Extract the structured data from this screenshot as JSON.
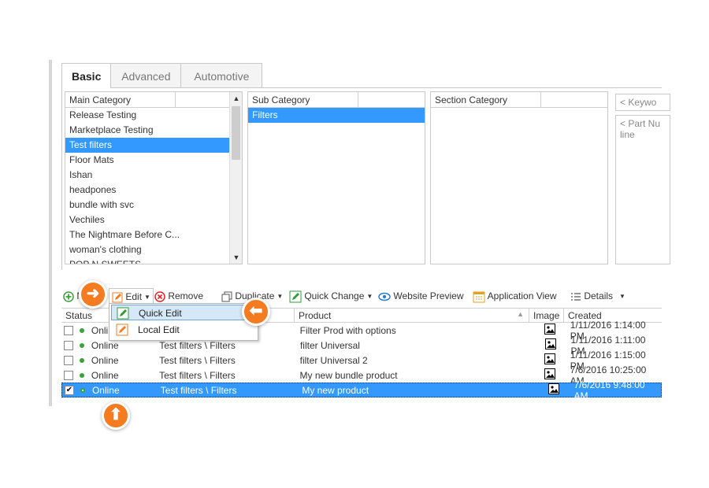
{
  "tabs": [
    "Basic",
    "Advanced",
    "Automotive"
  ],
  "main_category": {
    "header": "Main Category",
    "items": [
      "Release Testing",
      "Marketplace Testing",
      "Test filters",
      "Floor Mats",
      "Ishan",
      "headpones",
      "bundle with svc",
      "Vechiles",
      "The Nightmare Before C...",
      "woman's clothing",
      "POP N SWEETS"
    ],
    "selected": "Test filters"
  },
  "sub_category": {
    "header": "Sub Category",
    "items": [
      "Filters"
    ]
  },
  "section_category": {
    "header": "Section Category"
  },
  "keyword_placeholder": "< Keywo",
  "part_placeholder": "< Part Nu line",
  "toolbar": {
    "new_label": "N",
    "edit_label": "Edit",
    "remove_label": "Remove",
    "duplicate_label": "Duplicate",
    "quick_change_label": "Quick Change",
    "website_preview_label": "Website Preview",
    "application_view_label": "Application View",
    "details_label": "Details"
  },
  "edit_menu": {
    "items": [
      "Quick Edit",
      "Local Edit"
    ],
    "highlighted": "Quick Edit"
  },
  "grid": {
    "columns": [
      "Status",
      "Product",
      "Image",
      "Created"
    ],
    "rows": [
      {
        "checked": false,
        "status": "Onlin",
        "category": "",
        "product": "Filter Prod with options",
        "created": "1/11/2016 1:14:00 PM"
      },
      {
        "checked": false,
        "status": "Online",
        "category": "Test filters \\ Filters",
        "product": "filter Universal",
        "created": "1/11/2016 1:11:00 PM"
      },
      {
        "checked": false,
        "status": "Online",
        "category": "Test filters \\ Filters",
        "product": "filter Universal 2",
        "created": "1/11/2016 1:15:00 PM"
      },
      {
        "checked": false,
        "status": "Online",
        "category": "Test filters \\ Filters",
        "product": "My new bundle product",
        "created": "7/6/2016 10:25:00 AM"
      },
      {
        "checked": true,
        "status": "Online",
        "category": "Test filters \\ Filters",
        "product": "My new product",
        "created": "7/6/2016 9:48:00 AM"
      }
    ]
  },
  "colors": {
    "selection": "#3399ff",
    "badge": "#f47b20",
    "online": "#3aa23a"
  }
}
